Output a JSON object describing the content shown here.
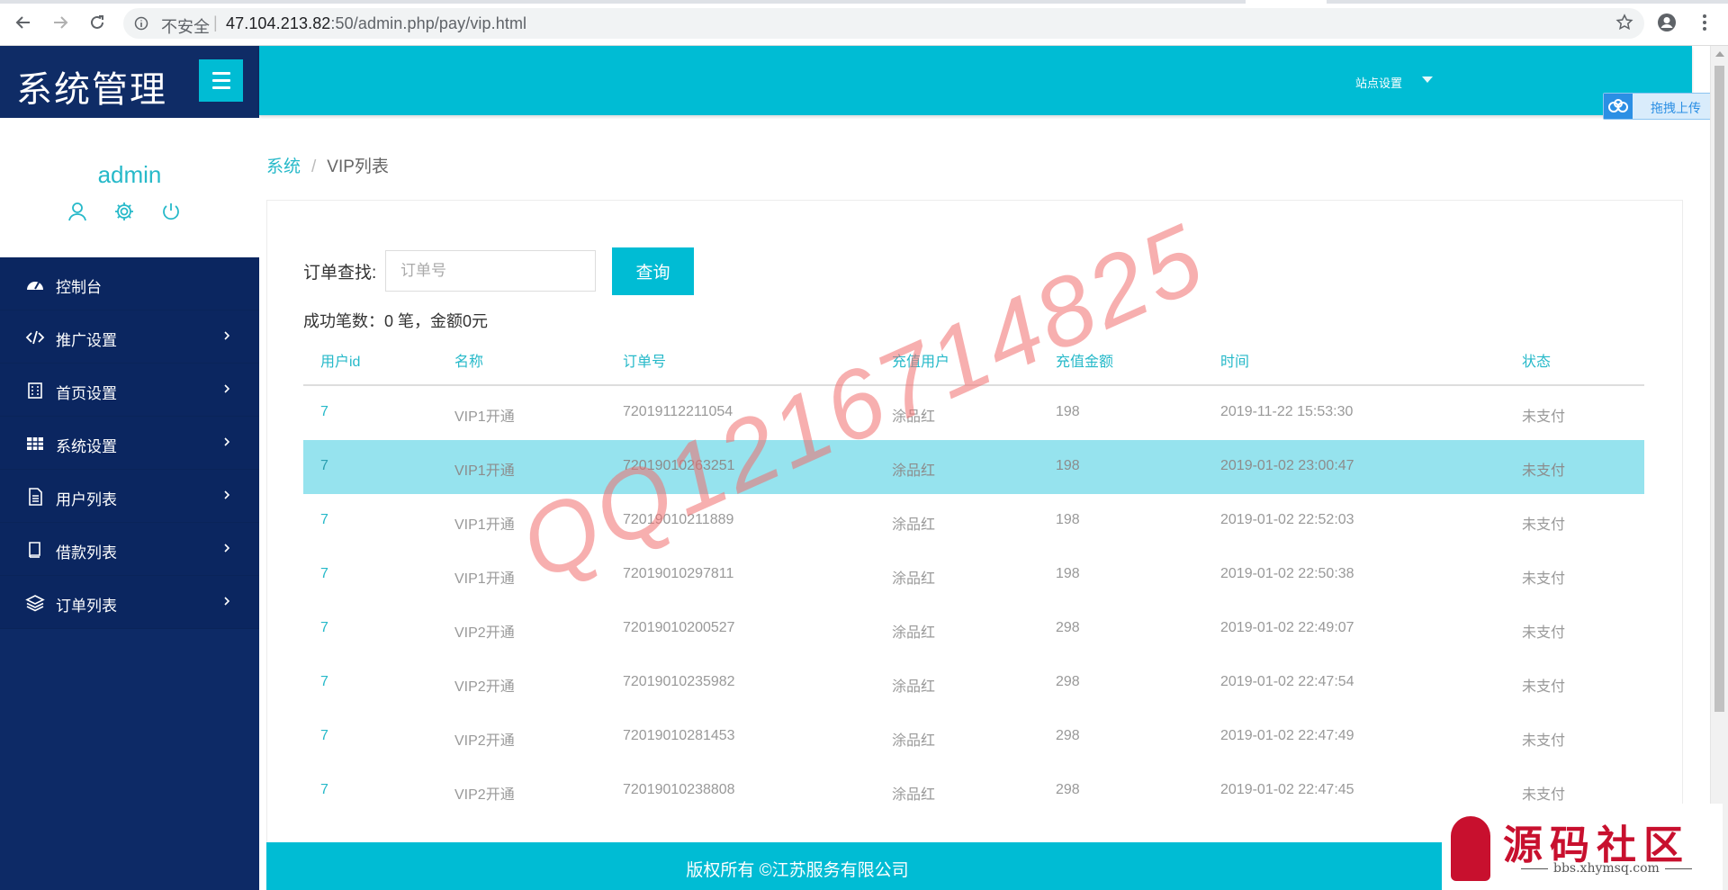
{
  "browser": {
    "security_label": "不安全",
    "url_host": "47.104.213.82",
    "url_rest": ":50/admin.php/pay/vip.html"
  },
  "sidebar": {
    "brand_title": "系统管理",
    "username": "admin",
    "items": [
      {
        "label": "控制台",
        "icon": "dashboard-icon"
      },
      {
        "label": "推广设置",
        "icon": "code-icon"
      },
      {
        "label": "首页设置",
        "icon": "building-icon"
      },
      {
        "label": "系统设置",
        "icon": "grid-icon"
      },
      {
        "label": "用户列表",
        "icon": "document-icon"
      },
      {
        "label": "借款列表",
        "icon": "book-icon"
      },
      {
        "label": "订单列表",
        "icon": "layers-icon"
      }
    ]
  },
  "header": {
    "site_settings": "站点设置",
    "upload_label": "拖拽上传"
  },
  "breadcrumb": {
    "home": "系统",
    "separator": "/",
    "current": "VIP列表"
  },
  "search": {
    "label": "订单查找:",
    "placeholder": "订单号",
    "button": "查询"
  },
  "summary": "成功笔数：0 笔，金额0元",
  "table": {
    "columns": [
      "用户id",
      "名称",
      "订单号",
      "充值用户",
      "充值金额",
      "时间",
      "状态"
    ],
    "rows": [
      [
        "7",
        "VIP1开通",
        "72019112211054",
        "涂品红",
        "198",
        "2019-11-22 15:53:30",
        "未支付"
      ],
      [
        "7",
        "VIP1开通",
        "72019010263251",
        "涂品红",
        "198",
        "2019-01-02 23:00:47",
        "未支付"
      ],
      [
        "7",
        "VIP1开通",
        "72019010211889",
        "涂品红",
        "198",
        "2019-01-02 22:52:03",
        "未支付"
      ],
      [
        "7",
        "VIP1开通",
        "72019010297811",
        "涂品红",
        "198",
        "2019-01-02 22:50:38",
        "未支付"
      ],
      [
        "7",
        "VIP2开通",
        "72019010200527",
        "涂品红",
        "298",
        "2019-01-02 22:49:07",
        "未支付"
      ],
      [
        "7",
        "VIP2开通",
        "72019010235982",
        "涂品红",
        "298",
        "2019-01-02 22:47:54",
        "未支付"
      ],
      [
        "7",
        "VIP2开通",
        "72019010281453",
        "涂品红",
        "298",
        "2019-01-02 22:47:49",
        "未支付"
      ],
      [
        "7",
        "VIP2开通",
        "72019010238808",
        "涂品红",
        "298",
        "2019-01-02 22:47:45",
        "未支付"
      ]
    ]
  },
  "footer": "版权所有 ©江苏服务有限公司",
  "watermark": "QQ1216714825",
  "logo": {
    "title": "源码社区",
    "url": "bbs.xhymsq.com"
  },
  "colors": {
    "accent": "#00bcd4",
    "sidebar": "#0d2a66",
    "highlight_row": "#96e3ee"
  }
}
